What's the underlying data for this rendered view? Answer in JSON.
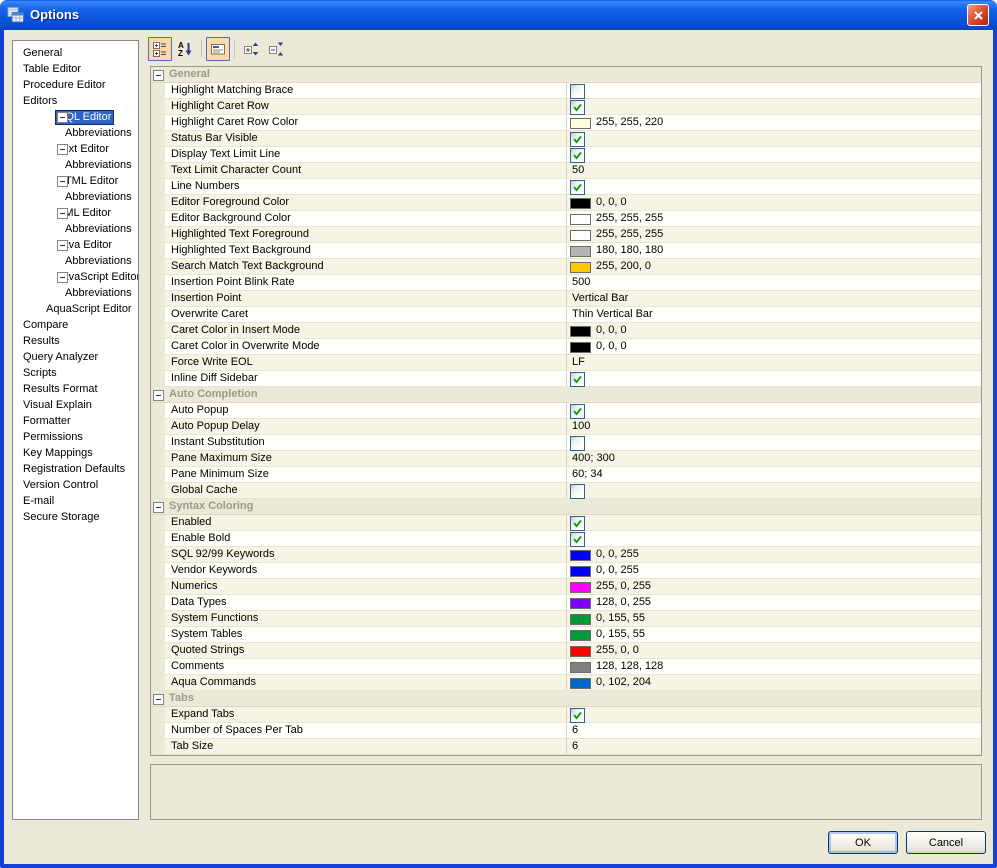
{
  "window": {
    "title": "Options"
  },
  "colors": {
    "titlebar_blue": "#0c55dc",
    "window_border": "#1440d8",
    "dialog_background": "#ece9d8",
    "selection_blue": "#2e62c4",
    "toolbar_selected": "#fcd9a6",
    "check_green": "#17a116",
    "category_text": "#9b998a",
    "row_white": "#fffffb",
    "row_cream": "#f6f4e4"
  },
  "toolbar": {
    "buttons": [
      {
        "name": "categorized-view",
        "selected": true
      },
      {
        "name": "sort-alphabetical",
        "selected": false
      },
      {
        "name": "show-description",
        "selected": true
      },
      {
        "name": "expand-all",
        "selected": false
      },
      {
        "name": "collapse-all",
        "selected": false
      }
    ]
  },
  "sidebar": {
    "items": [
      {
        "label": "General",
        "level": 0
      },
      {
        "label": "Table Editor",
        "level": 0
      },
      {
        "label": "Procedure Editor",
        "level": 0
      },
      {
        "label": "Editors",
        "level": 0
      },
      {
        "label": "SQL Editor",
        "level": 1,
        "toggle": true,
        "selected": true
      },
      {
        "label": "Abbreviations",
        "level": 2
      },
      {
        "label": "Text Editor",
        "level": 1,
        "toggle": true
      },
      {
        "label": "Abbreviations",
        "level": 2
      },
      {
        "label": "HTML Editor",
        "level": 1,
        "toggle": true
      },
      {
        "label": "Abbreviations",
        "level": 2
      },
      {
        "label": "XML Editor",
        "level": 1,
        "toggle": true
      },
      {
        "label": "Abbreviations",
        "level": 2
      },
      {
        "label": "Java Editor",
        "level": 1,
        "toggle": true
      },
      {
        "label": "Abbreviations",
        "level": 2
      },
      {
        "label": "JavaScript Editor",
        "level": 1,
        "toggle": true
      },
      {
        "label": "Abbreviations",
        "level": 2
      },
      {
        "label": "AquaScript Editor",
        "level": 1
      },
      {
        "label": "Compare",
        "level": 0
      },
      {
        "label": "Results",
        "level": 0
      },
      {
        "label": "Query Analyzer",
        "level": 0
      },
      {
        "label": "Scripts",
        "level": 0
      },
      {
        "label": "Results Format",
        "level": 0
      },
      {
        "label": "Visual Explain",
        "level": 0
      },
      {
        "label": "Formatter",
        "level": 0
      },
      {
        "label": "Permissions",
        "level": 0
      },
      {
        "label": "Key Mappings",
        "level": 0
      },
      {
        "label": "Registration Defaults",
        "level": 0
      },
      {
        "label": "Version Control",
        "level": 0
      },
      {
        "label": "E-mail",
        "level": 0
      },
      {
        "label": "Secure Storage",
        "level": 0
      }
    ]
  },
  "property_grid": {
    "sections": [
      {
        "title": "General",
        "rows": [
          {
            "label": "Highlight Matching Brace",
            "type": "checkbox",
            "checked": false
          },
          {
            "label": "Highlight Caret Row",
            "type": "checkbox",
            "checked": true
          },
          {
            "label": "Highlight Caret Row Color",
            "type": "color",
            "hex": "#FFFFDC",
            "text": "255, 255, 220"
          },
          {
            "label": "Status Bar Visible",
            "type": "checkbox",
            "checked": true
          },
          {
            "label": "Display Text Limit Line",
            "type": "checkbox",
            "checked": true
          },
          {
            "label": "Text Limit Character Count",
            "type": "text",
            "text": "50"
          },
          {
            "label": "Line Numbers",
            "type": "checkbox",
            "checked": true
          },
          {
            "label": "Editor Foreground Color",
            "type": "color",
            "hex": "#000000",
            "text": "0, 0, 0"
          },
          {
            "label": "Editor Background Color",
            "type": "color",
            "hex": "#FFFFFF",
            "text": "255, 255, 255"
          },
          {
            "label": "Highlighted Text Foreground",
            "type": "color",
            "hex": "#FFFFFF",
            "text": "255, 255, 255"
          },
          {
            "label": "Highlighted Text Background",
            "type": "color",
            "hex": "#B4B4B4",
            "text": "180, 180, 180"
          },
          {
            "label": "Search Match Text Background",
            "type": "color",
            "hex": "#FFC800",
            "text": "255, 200, 0"
          },
          {
            "label": "Insertion Point Blink Rate",
            "type": "text",
            "text": "500"
          },
          {
            "label": "Insertion Point",
            "type": "text",
            "text": "Vertical Bar"
          },
          {
            "label": "Overwrite Caret",
            "type": "text",
            "text": "Thin Vertical Bar"
          },
          {
            "label": "Caret Color in Insert Mode",
            "type": "color",
            "hex": "#000000",
            "text": "0, 0, 0"
          },
          {
            "label": "Caret Color in Overwrite Mode",
            "type": "color",
            "hex": "#000000",
            "text": "0, 0, 0"
          },
          {
            "label": "Force Write EOL",
            "type": "text",
            "text": "LF"
          },
          {
            "label": "Inline Diff Sidebar",
            "type": "checkbox",
            "checked": true
          }
        ]
      },
      {
        "title": "Auto Completion",
        "rows": [
          {
            "label": "Auto Popup",
            "type": "checkbox",
            "checked": true
          },
          {
            "label": "Auto Popup Delay",
            "type": "text",
            "text": "100"
          },
          {
            "label": "Instant Substitution",
            "type": "checkbox",
            "checked": false
          },
          {
            "label": "Pane Maximum Size",
            "type": "text",
            "text": "400; 300"
          },
          {
            "label": "Pane Minimum Size",
            "type": "text",
            "text": "60; 34"
          },
          {
            "label": "Global Cache",
            "type": "checkbox",
            "checked": false
          }
        ]
      },
      {
        "title": "Syntax Coloring",
        "rows": [
          {
            "label": "Enabled",
            "type": "checkbox",
            "checked": true
          },
          {
            "label": "Enable Bold",
            "type": "checkbox",
            "checked": true
          },
          {
            "label": "SQL 92/99 Keywords",
            "type": "color",
            "hex": "#0000FF",
            "text": "0, 0, 255"
          },
          {
            "label": "Vendor Keywords",
            "type": "color",
            "hex": "#0000FF",
            "text": "0, 0, 255"
          },
          {
            "label": "Numerics",
            "type": "color",
            "hex": "#FF00FF",
            "text": "255, 0, 255"
          },
          {
            "label": "Data Types",
            "type": "color",
            "hex": "#8000FF",
            "text": "128, 0, 255"
          },
          {
            "label": "System Functions",
            "type": "color",
            "hex": "#009B37",
            "text": "0, 155, 55"
          },
          {
            "label": "System Tables",
            "type": "color",
            "hex": "#009B37",
            "text": "0, 155, 55"
          },
          {
            "label": "Quoted Strings",
            "type": "color",
            "hex": "#FF0000",
            "text": "255, 0, 0"
          },
          {
            "label": "Comments",
            "type": "color",
            "hex": "#808080",
            "text": "128, 128, 128"
          },
          {
            "label": "Aqua Commands",
            "type": "color",
            "hex": "#0066CC",
            "text": "0, 102, 204"
          }
        ]
      },
      {
        "title": "Tabs",
        "rows": [
          {
            "label": "Expand Tabs",
            "type": "checkbox",
            "checked": true
          },
          {
            "label": "Number of Spaces Per Tab",
            "type": "text",
            "text": "6"
          },
          {
            "label": "Tab Size",
            "type": "text",
            "text": "6"
          }
        ]
      }
    ]
  },
  "description_panel": {
    "text": ""
  },
  "buttons": {
    "ok_label": "OK",
    "cancel_label": "Cancel"
  }
}
